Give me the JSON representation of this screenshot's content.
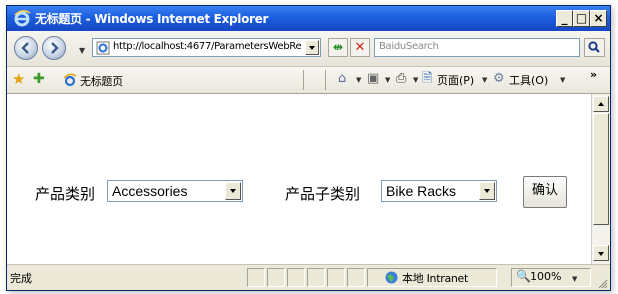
{
  "window": {
    "title": "无标题页 - Windows Internet Explorer",
    "minimize_label": "_",
    "maximize_label": "□",
    "close_label": "×"
  },
  "toolbar": {
    "address_url": "http://localhost:4677/ParametersWebRe",
    "search_placeholder": "BaiduSearch",
    "refresh_icon": "↮",
    "stop_icon": "✕"
  },
  "favorites_bar": {
    "tab_title": "无标题页",
    "page_menu": "页面(P)",
    "tools_menu": "工具(O)",
    "overflow": "»"
  },
  "form": {
    "category_label": "产品类别",
    "category_value": "Accessories",
    "subcategory_label": "产品子类别",
    "subcategory_value": "Bike Racks",
    "confirm_label": "确认"
  },
  "status": {
    "text": "完成",
    "zone": "本地 Intranet",
    "zoom": "100%"
  },
  "colors": {
    "title_bar": "#1c5fe0",
    "accent": "#3a80f3"
  }
}
